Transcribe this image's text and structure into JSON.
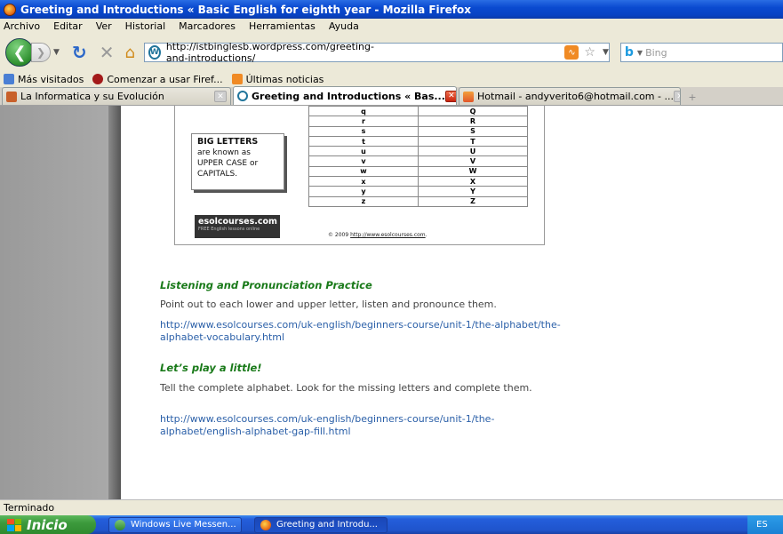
{
  "window": {
    "title": "Greeting and Introductions « Basic English for eighth year - Mozilla Firefox"
  },
  "menu": [
    "Archivo",
    "Editar",
    "Ver",
    "Historial",
    "Marcadores",
    "Herramientas",
    "Ayuda"
  ],
  "nav": {
    "url": "http://istbinglesb.wordpress.com/greeting-and-introductions/",
    "search_placeholder": "Bing",
    "back_icon": "back-arrow-icon",
    "forward_icon": "forward-arrow-icon",
    "reload_icon": "reload-icon",
    "stop_icon": "stop-icon",
    "home_icon": "home-icon"
  },
  "bookmarks": [
    "Más visitados",
    "Comenzar a usar Firef...",
    "Últimas noticias"
  ],
  "tabs": [
    {
      "label": "La Informatica y su Evolución",
      "active": false
    },
    {
      "label": "Greeting and Introductions « Bas...",
      "active": true
    },
    {
      "label": "Hotmail - andyverito6@hotmail.com - ...",
      "active": false
    }
  ],
  "figure": {
    "rows": [
      [
        "q",
        "Q"
      ],
      [
        "r",
        "R"
      ],
      [
        "s",
        "S"
      ],
      [
        "t",
        "T"
      ],
      [
        "u",
        "U"
      ],
      [
        "v",
        "V"
      ],
      [
        "w",
        "W"
      ],
      [
        "x",
        "X"
      ],
      [
        "y",
        "Y"
      ],
      [
        "z",
        "Z"
      ]
    ],
    "note_big": "BIG LETTERS",
    "note_lines": [
      "are known as",
      "UPPER CASE or",
      "CAPITALS."
    ],
    "logo_brand": "esolcourses.com",
    "logo_tag": "FREE English lessons online",
    "copyright_prefix": "© 2009",
    "copyright_link": "http://www.esolcourses.com"
  },
  "article": {
    "heading1": "Listening and Pronunciation Practice",
    "para1": "Point out to each lower and upper letter, listen and pronounce them.",
    "link1": "http://www.esolcourses.com/uk-english/beginners-course/unit-1/the-alphabet/the-alphabet-vocabulary.html",
    "heading2": "Let’s play a little!",
    "para2": "Tell the complete alphabet.  Look for the missing letters and complete them.",
    "link2": "http://www.esolcourses.com/uk-english/beginners-course/unit-1/the-alphabet/english-alphabet-gap-fill.html"
  },
  "status": "Terminado",
  "taskbar": {
    "start": "Inicio",
    "items": [
      "Windows Live Messen...",
      "Greeting and Introdu..."
    ],
    "tray": "ES"
  }
}
